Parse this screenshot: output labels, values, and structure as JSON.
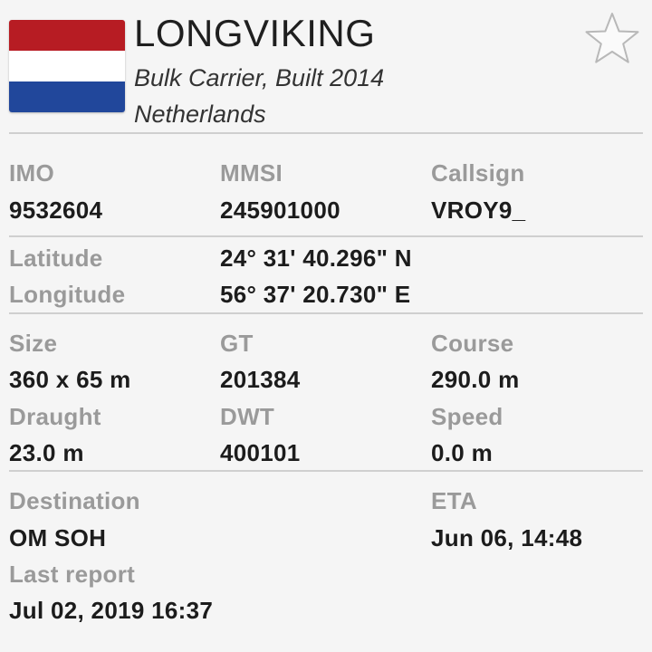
{
  "vessel": {
    "name": "LONGVIKING",
    "type_built": "Bulk Carrier, Built 2014",
    "country": "Netherlands",
    "flag_colors": [
      "#b71c23",
      "#ffffff",
      "#21479b"
    ]
  },
  "favorite_icon": "star-outline-icon",
  "identifiers": {
    "imo_label": "IMO",
    "imo": "9532604",
    "mmsi_label": "MMSI",
    "mmsi": "245901000",
    "callsign_label": "Callsign",
    "callsign": "VROY9_"
  },
  "position": {
    "latitude_label": "Latitude",
    "latitude": "24° 31' 40.296\" N",
    "longitude_label": "Longitude",
    "longitude": "56° 37' 20.730\" E"
  },
  "dimensions": {
    "size_label": "Size",
    "size": "360 x 65 m",
    "gt_label": "GT",
    "gt": "201384",
    "course_label": "Course",
    "course": "290.0 m",
    "draught_label": "Draught",
    "draught": "23.0 m",
    "dwt_label": "DWT",
    "dwt": "400101",
    "speed_label": "Speed",
    "speed": "0.0 m"
  },
  "voyage": {
    "destination_label": "Destination",
    "destination": "OM SOH",
    "eta_label": "ETA",
    "eta": "Jun 06, 14:48",
    "last_report_label": "Last report",
    "last_report": "Jul 02, 2019 16:37"
  }
}
